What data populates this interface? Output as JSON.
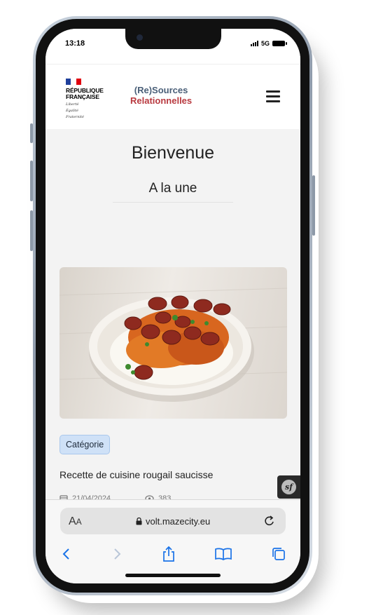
{
  "status_bar": {
    "time": "13:18",
    "network": "5G"
  },
  "header": {
    "rf_line1": "RÉPUBLIQUE",
    "rf_line2": "FRANÇAISE",
    "devise_1": "Liberté",
    "devise_2": "Égalité",
    "devise_3": "Fraternité",
    "brand_line1": "(Re)Sources",
    "brand_line2": "Relationnelles",
    "menu_icon": "hamburger-icon"
  },
  "main": {
    "welcome": "Bienvenue",
    "section_title": "A la une"
  },
  "card": {
    "category": "Catégorie",
    "title": "Recette de cuisine rougail saucisse",
    "date": "21/04/2024",
    "views": "383"
  },
  "browser": {
    "aa_big": "A",
    "aa_small": "A",
    "url": "volt.mazecity.eu"
  },
  "colors": {
    "brand_blue": "#4a5f78",
    "brand_red": "#b8393f",
    "badge_bg": "#cfe1f7",
    "safari_blue": "#1a73e8"
  }
}
